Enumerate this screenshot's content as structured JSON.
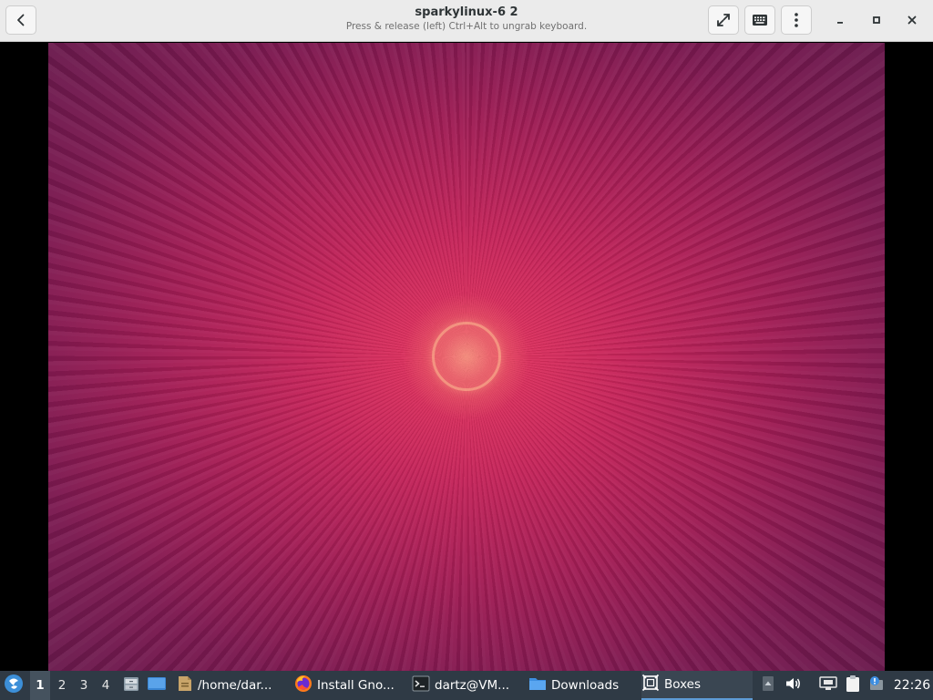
{
  "window": {
    "title": "sparkylinux-6 2",
    "subtitle": "Press & release (left) Ctrl+Alt to ungrab keyboard."
  },
  "header_buttons": {
    "back": "back-arrow-icon",
    "fullscreen": "fullscreen-icon",
    "keyboard": "keyboard-icon",
    "menu": "kebab-menu-icon",
    "minimize": "minimize-icon",
    "maximize": "maximize-icon",
    "close": "close-icon"
  },
  "guest": {
    "wallpaper": {
      "colors": {
        "center": "#e8365f",
        "mid": "#9c1c54",
        "edge": "#6a1a4d",
        "ring": "#ffc896"
      }
    },
    "taskbar": {
      "workspaces": [
        "1",
        "2",
        "3",
        "4"
      ],
      "active_workspace": "1",
      "tasks": [
        {
          "label": "/home/dar...",
          "icon": "file-manager-icon"
        },
        {
          "label": "Install Gno...",
          "icon": "firefox-icon"
        },
        {
          "label": "dartz@VM...",
          "icon": "terminal-icon"
        },
        {
          "label": "Downloads",
          "icon": "folder-icon"
        },
        {
          "label": "Boxes",
          "icon": "boxes-icon",
          "active": true
        }
      ],
      "clock": "22:26"
    }
  },
  "colors": {
    "header_bg": "#ebebeb",
    "taskbar_bg": "#2f3a45",
    "accent": "#5d9bd6"
  }
}
